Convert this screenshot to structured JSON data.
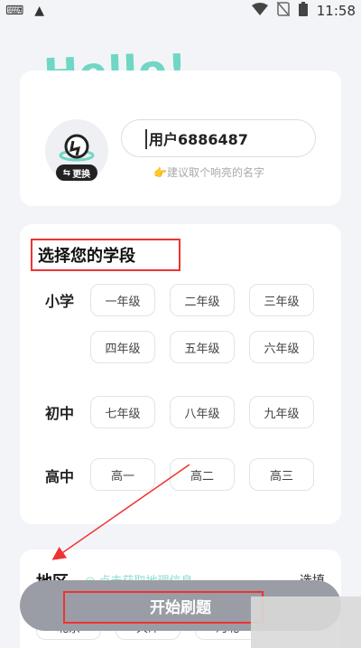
{
  "status_bar": {
    "time": "11:58"
  },
  "hello_text": "Hello!",
  "profile": {
    "username_value": "用户6886487",
    "swap_label": "更换",
    "hint": "👉建议取个响亮的名字"
  },
  "grade_section": {
    "title": "选择您的学段",
    "stages": [
      {
        "label": "小学",
        "grades": [
          "一年级",
          "二年级",
          "三年级",
          "四年级",
          "五年级",
          "六年级"
        ]
      },
      {
        "label": "初中",
        "grades": [
          "七年级",
          "八年级",
          "九年级"
        ]
      },
      {
        "label": "高中",
        "grades": [
          "高一",
          "高二",
          "高三"
        ]
      }
    ]
  },
  "region_section": {
    "title": "地区",
    "locate_text": "◎ 点击获取地理信息",
    "select_label": "选填",
    "chips": [
      "北京",
      "天津",
      "河北"
    ]
  },
  "start_button": {
    "label": "开始刷题"
  },
  "colors": {
    "accent": "#6fd7c4",
    "highlight": "#e33333",
    "button": "#9a9da5"
  }
}
